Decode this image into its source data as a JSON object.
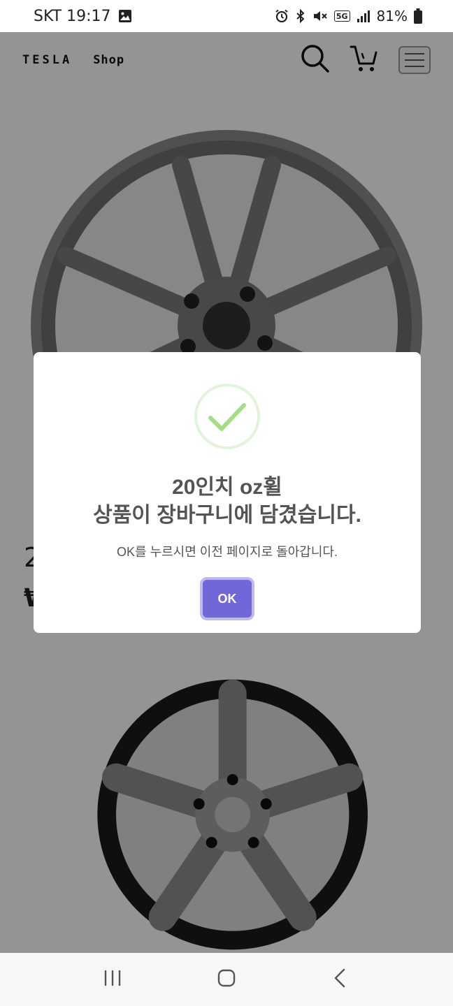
{
  "status_bar": {
    "carrier_time": "SKT 19:17",
    "network": "5G",
    "battery": "81%",
    "icons": [
      "gallery-icon",
      "alarm-icon",
      "bluetooth-icon",
      "mute-icon",
      "signal-icon",
      "battery-icon"
    ]
  },
  "header": {
    "logo": "TESLA",
    "shop_label": "Shop",
    "icons": [
      "search-icon",
      "cart-icon",
      "menu-icon"
    ]
  },
  "product": {
    "title_partial": "2",
    "price_partial": "₩"
  },
  "dialog": {
    "title_line1": "20인치 oz휠",
    "title_line2": "상품이 장바구니에 담겼습니다.",
    "message": "OK를 누르시면 이전 페이지로 돌아갑니다.",
    "ok_label": "OK",
    "success_color": "#a5dc86",
    "button_color": "#7267d9"
  },
  "navigation_bar": {
    "icons": [
      "recent-apps-icon",
      "home-icon",
      "back-icon"
    ]
  }
}
